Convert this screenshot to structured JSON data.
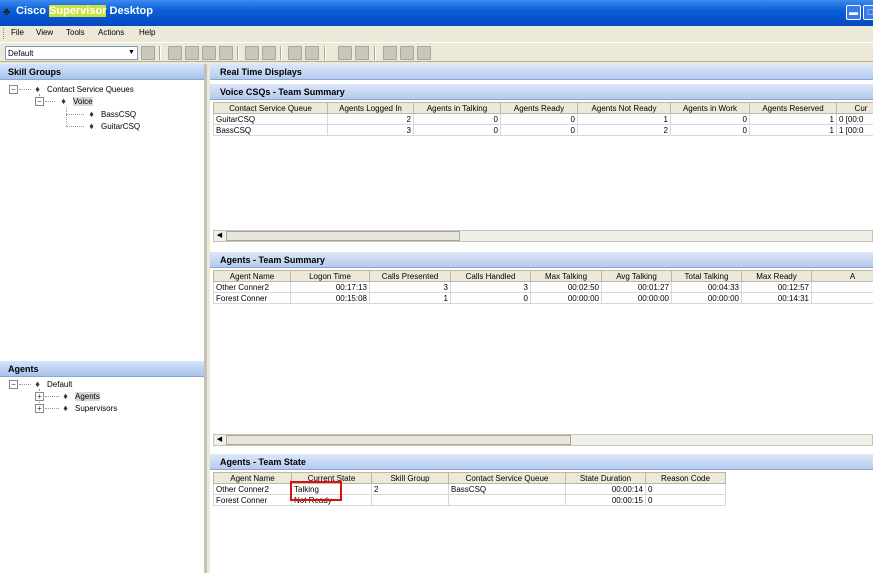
{
  "window": {
    "title_prefix": "Cisco ",
    "title_highlight": "Supervisor",
    "title_suffix": " Desktop"
  },
  "menu": [
    "File",
    "View",
    "Tools",
    "Actions",
    "Help"
  ],
  "toolbar": {
    "team_select": "Default"
  },
  "skill_groups": {
    "header": "Skill Groups",
    "root": "Contact Service Queues",
    "group": "Voice",
    "queues": [
      "BassCSQ",
      "GuitarCSQ"
    ]
  },
  "agents_tree": {
    "header": "Agents",
    "root": "Default",
    "children": [
      "Agents",
      "Supervisors"
    ]
  },
  "real_time": {
    "header": "Real Time Displays"
  },
  "voice_csqs": {
    "title": "Voice CSQs - Team Summary",
    "columns": [
      "Contact Service Queue",
      "Agents Logged In",
      "Agents in Talking",
      "Agents Ready",
      "Agents Not Ready",
      "Agents in Work",
      "Agents Reserved",
      "Cur"
    ],
    "rows": [
      [
        "GuitarCSQ",
        "2",
        "0",
        "0",
        "1",
        "0",
        "1",
        "0 [00:0"
      ],
      [
        "BassCSQ",
        "3",
        "0",
        "0",
        "2",
        "0",
        "1",
        "1 [00:0"
      ]
    ]
  },
  "agents_summary": {
    "title": "Agents - Team Summary",
    "columns": [
      "Agent Name",
      "Logon Time",
      "Calls Presented",
      "Calls Handled",
      "Max Talking",
      "Avg Talking",
      "Total Talking",
      "Max Ready",
      "A"
    ],
    "rows": [
      [
        "Other Conner2",
        "00:17:13",
        "3",
        "3",
        "00:02:50",
        "00:01:27",
        "00:04:33",
        "00:12:57",
        ""
      ],
      [
        "Forest Conner",
        "00:15:08",
        "1",
        "0",
        "00:00:00",
        "00:00:00",
        "00:00:00",
        "00:14:31",
        ""
      ]
    ]
  },
  "team_state": {
    "title": "Agents - Team State",
    "columns": [
      "Agent Name",
      "Current State",
      "Skill Group",
      "Contact Service Queue",
      "State Duration",
      "Reason Code"
    ],
    "rows": [
      [
        "Other Conner2",
        "Talking",
        "2",
        "BassCSQ",
        "00:00:14",
        "0"
      ],
      [
        "Forest Conner",
        "Not Ready",
        "",
        "",
        "00:00:15",
        "0"
      ]
    ]
  }
}
